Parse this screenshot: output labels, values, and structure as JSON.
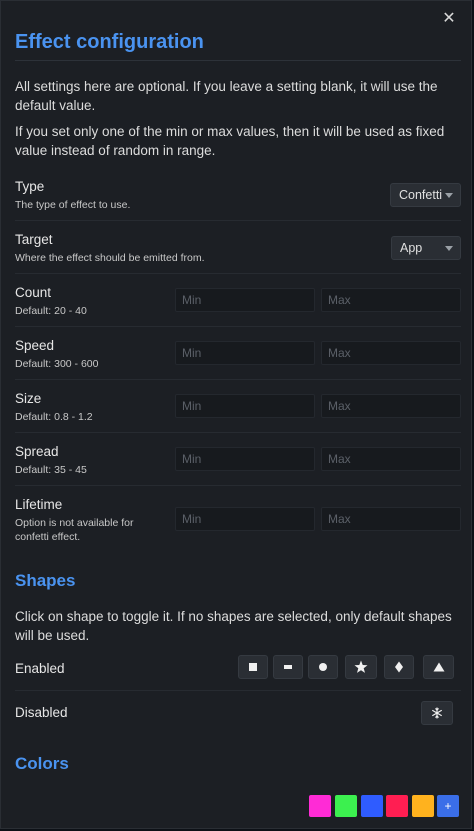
{
  "dialog": {
    "close_icon": "close-icon",
    "close_glyph": "✕",
    "title": "Effect configuration",
    "intro_1": "All settings here are optional. If you leave a setting blank, it will use the default value.",
    "intro_2": "If you set only one of the min or max values, then it will be used as fixed value instead of random in range."
  },
  "settings": {
    "type": {
      "label": "Type",
      "desc": "The type of effect to use.",
      "value": "Confetti"
    },
    "target": {
      "label": "Target",
      "desc": "Where the effect should be emitted from.",
      "value": "App"
    },
    "count": {
      "label": "Count",
      "desc": "Default: 20 - 40",
      "min_placeholder": "Min",
      "max_placeholder": "Max"
    },
    "speed": {
      "label": "Speed",
      "desc": "Default: 300 - 600",
      "min_placeholder": "Min",
      "max_placeholder": "Max"
    },
    "size": {
      "label": "Size",
      "desc": "Default: 0.8 - 1.2",
      "min_placeholder": "Min",
      "max_placeholder": "Max"
    },
    "spread": {
      "label": "Spread",
      "desc": "Default: 35 - 45",
      "min_placeholder": "Min",
      "max_placeholder": "Max"
    },
    "lifetime": {
      "label": "Lifetime",
      "desc": "Option is not available for confetti effect.",
      "min_placeholder": "Min",
      "max_placeholder": "Max"
    }
  },
  "shapes": {
    "title": "Shapes",
    "hint": "Click on shape to toggle it. If no shapes are selected, only default shapes will be used.",
    "enabled_label": "Enabled",
    "disabled_label": "Disabled",
    "enabled_icons": [
      "square-icon",
      "rectangle-icon",
      "circle-icon",
      "star-icon",
      "diamond-icon",
      "triangle-icon"
    ],
    "disabled_icons": [
      "snowflake-icon"
    ]
  },
  "colors": {
    "title": "Colors",
    "swatches": [
      "#ff2bd6",
      "#3cf04f",
      "#2f5cff",
      "#ff1e52",
      "#ffb21e"
    ],
    "add_label": "+",
    "add_color": "#3a6ee8"
  }
}
